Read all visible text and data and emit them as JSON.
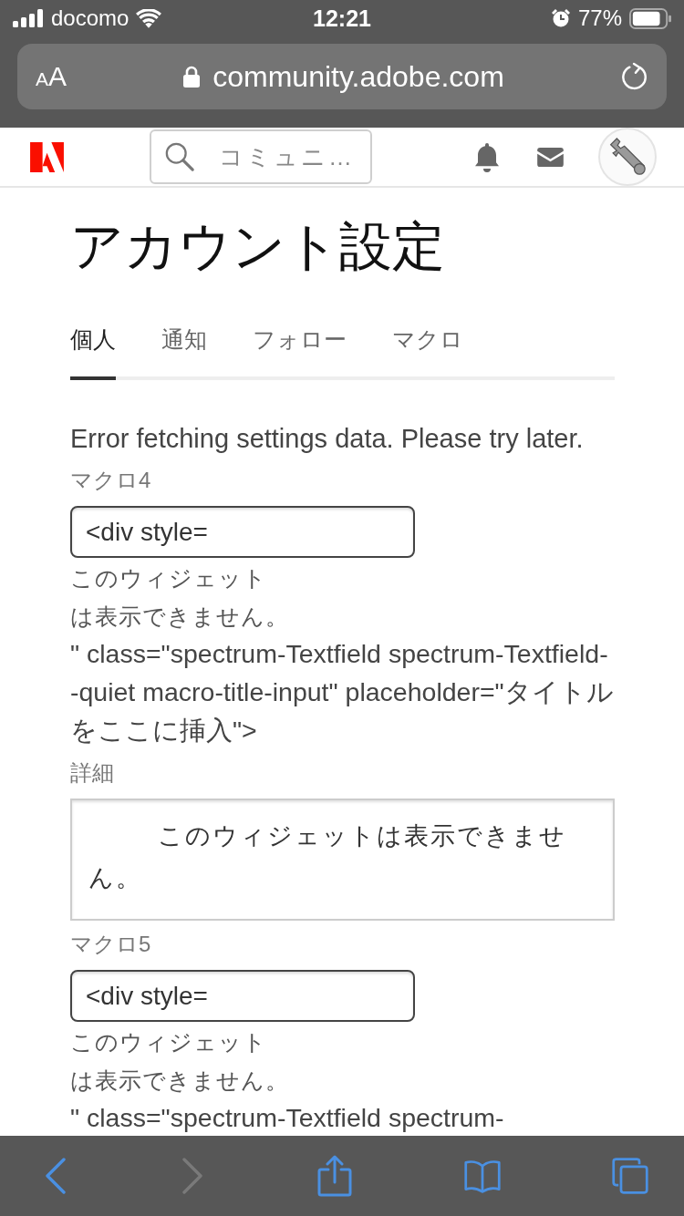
{
  "status_bar": {
    "carrier": "docomo",
    "time": "12:21",
    "battery": "77%"
  },
  "address_bar": {
    "text_size_small": "A",
    "text_size_large": "A",
    "url": "community.adobe.com"
  },
  "header": {
    "search": {
      "placeholder": "コミュニ…"
    }
  },
  "page": {
    "title": "アカウント設定",
    "tabs": [
      {
        "label": "個人",
        "selected": true
      },
      {
        "label": "通知",
        "selected": false
      },
      {
        "label": "フォロー",
        "selected": false
      },
      {
        "label": "マクロ",
        "selected": false
      }
    ],
    "error": "Error fetching settings data. Please try later.",
    "macros": [
      {
        "label": "マクロ4",
        "value": "<div style=",
        "widget_note": [
          "このウィジェット",
          "は表示できません。"
        ],
        "code": "\" class=\"spectrum-Textfield spectrum-Textfield--quiet macro-title-input\" placeholder=\"タイトルをここに挿入\">",
        "details_label": "詳細",
        "details_text": "このウィジェットは表示できません。"
      },
      {
        "label": "マクロ5",
        "value": "<div style=",
        "widget_note": [
          "このウィジェット",
          "は表示できません。"
        ],
        "code": "\" class=\"spectrum-Textfield spectrum-"
      }
    ]
  },
  "toolbar": {
    "back": {
      "disabled": false
    },
    "forward": {
      "disabled": true
    }
  }
}
